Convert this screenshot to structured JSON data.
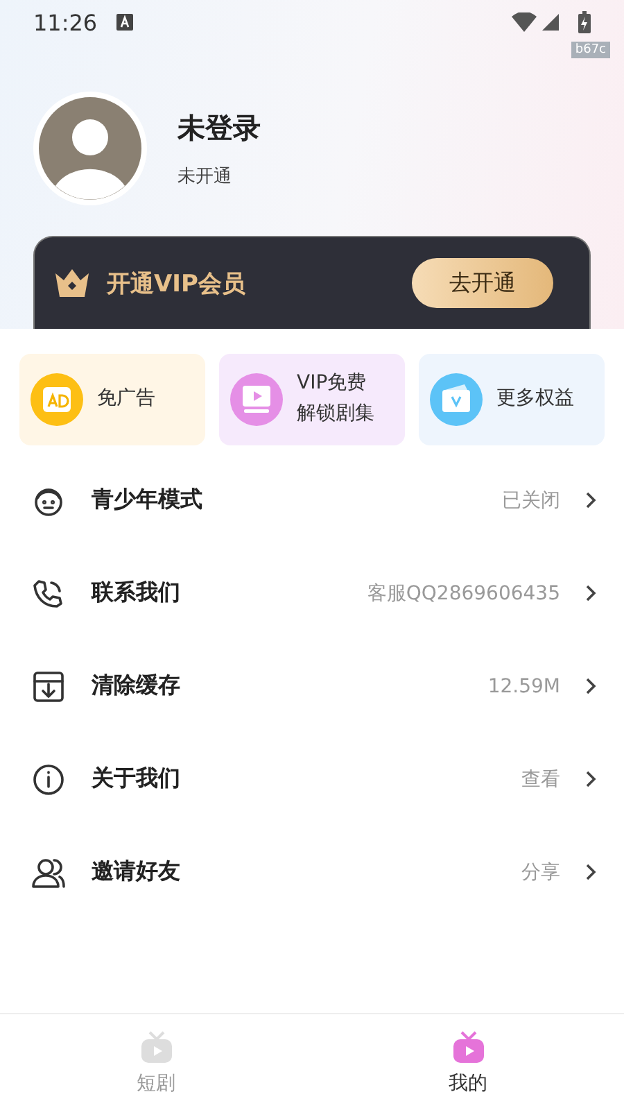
{
  "status_bar": {
    "time": "11:26",
    "tag": "b67c"
  },
  "profile": {
    "name": "未登录",
    "subtitle": "未开通"
  },
  "vip_banner": {
    "title": "开通VIP会员",
    "button": "去开通"
  },
  "perks": [
    {
      "kind": "ad",
      "label": "免广告",
      "color": "#fff6e6"
    },
    {
      "kind": "play",
      "label": "VIP免费解锁剧集",
      "color": "#f6eafc"
    },
    {
      "kind": "more",
      "label": "更多权益",
      "color": "#eef5fd"
    }
  ],
  "menu": [
    {
      "kind": "teen",
      "label": "青少年模式",
      "value": "已关闭"
    },
    {
      "kind": "contact",
      "label": "联系我们",
      "value": "客服QQ2869606435"
    },
    {
      "kind": "cache",
      "label": "清除缓存",
      "value": "12.59M"
    },
    {
      "kind": "about",
      "label": "关于我们",
      "value": "查看"
    },
    {
      "kind": "invite",
      "label": "邀请好友",
      "value": "分享"
    }
  ],
  "tabs": [
    {
      "label": "短剧",
      "selected": false
    },
    {
      "label": "我的",
      "selected": true
    }
  ]
}
